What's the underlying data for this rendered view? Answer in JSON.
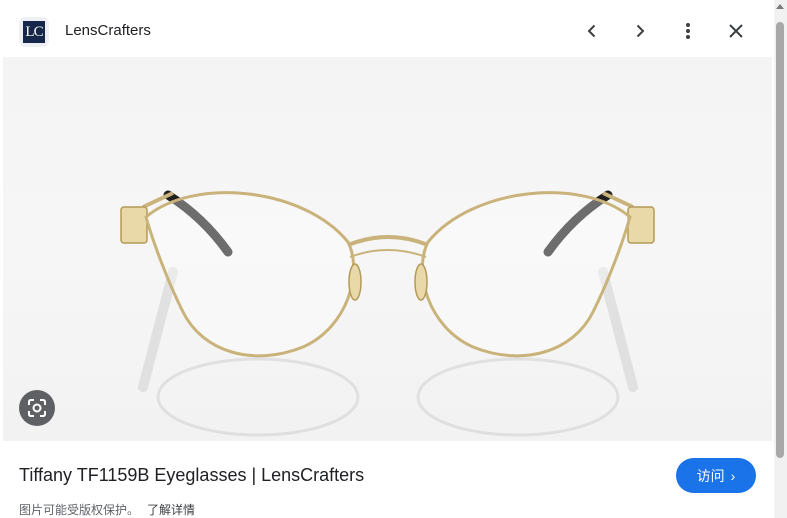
{
  "header": {
    "site_name": "LensCrafters",
    "logo_text": "LC",
    "prev_icon": "chevron-left-icon",
    "next_icon": "chevron-right-icon",
    "more_icon": "more-vert-icon",
    "close_icon": "close-icon"
  },
  "image": {
    "subject_icon": "eyeglasses-image",
    "lens_icon": "google-lens-icon"
  },
  "result": {
    "title": "Tiffany TF1159B Eyeglasses | LensCrafters",
    "visit_label": "访问",
    "visit_chevron": "›",
    "copyright_notice": "图片可能受版权保护。",
    "learn_more": "了解详情"
  },
  "colors": {
    "accent": "#1a73e8",
    "logo_bg": "#16284a",
    "frame_gold": "#c9b37a"
  }
}
